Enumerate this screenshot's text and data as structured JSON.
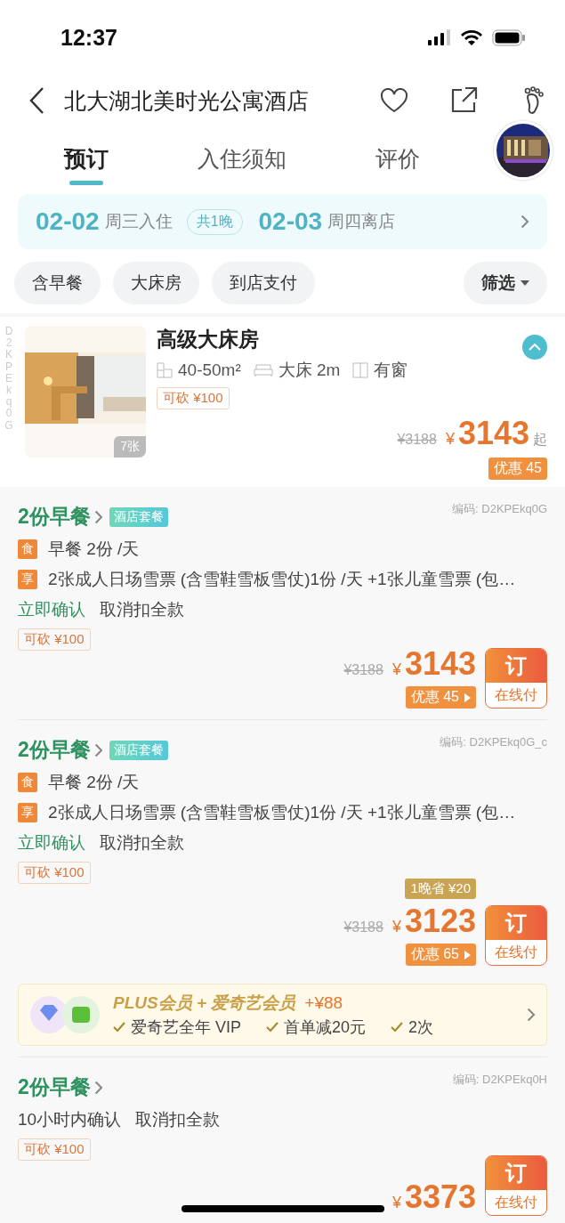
{
  "status_bar": {
    "time": "12:37"
  },
  "header": {
    "title": "北大湖北美时光公寓酒店"
  },
  "tabs": [
    {
      "label": "预订",
      "selected": true
    },
    {
      "label": "入住须知",
      "selected": false
    },
    {
      "label": "评价",
      "selected": false
    }
  ],
  "dates": {
    "checkin_date": "02-02",
    "checkin_label": "周三入住",
    "nights": "共1晚",
    "checkout_date": "02-03",
    "checkout_label": "周四离店"
  },
  "filters": [
    {
      "label": "含早餐",
      "kind": "chip"
    },
    {
      "label": "大床房",
      "kind": "chip"
    },
    {
      "label": "到店支付",
      "kind": "chip"
    },
    {
      "label": "筛选",
      "kind": "dropdown"
    }
  ],
  "room": {
    "side_code": "D2KPEkq0G",
    "photo_count": "7张",
    "name": "高级大床房",
    "expanded": true,
    "features": [
      {
        "kind": "area",
        "text": "40-50m²"
      },
      {
        "kind": "bed",
        "text": "大床 2m"
      },
      {
        "kind": "window",
        "text": "有窗"
      }
    ],
    "bargain": "可砍 ¥100",
    "old_price": "¥3188",
    "currency": "¥",
    "price": "3143",
    "suffix": "起",
    "discount": "优惠 45"
  },
  "packages": [
    {
      "title": "2份早餐",
      "tag": "酒店套餐",
      "code": "编码: D2KPEkq0G",
      "perks": [
        {
          "icon": "食",
          "text": "早餐 2份 /天"
        },
        {
          "icon": "享",
          "text": "2张成人日场雪票 (含雪鞋雪板雪仗)1份 /天 +1张儿童雪票 (包…"
        }
      ],
      "confirm": "立即确认",
      "instant": true,
      "cancel": "取消扣全款",
      "bargain": "可砍 ¥100",
      "old_price": "¥3188",
      "currency": "¥",
      "price": "3143",
      "discount": "优惠 45",
      "book": "订",
      "pay": "在线付"
    },
    {
      "title": "2份早餐",
      "tag": "酒店套餐",
      "code": "编码: D2KPEkq0G_c",
      "perks": [
        {
          "icon": "食",
          "text": "早餐 2份 /天"
        },
        {
          "icon": "享",
          "text": "2张成人日场雪票 (含雪鞋雪板雪仗)1份 /天 +1张儿童雪票 (包…"
        }
      ],
      "confirm": "立即确认",
      "instant": true,
      "cancel": "取消扣全款",
      "bargain": "可砍 ¥100",
      "saving": "1晚省 ¥20",
      "old_price": "¥3188",
      "currency": "¥",
      "price": "3123",
      "discount": "优惠 65",
      "book": "订",
      "pay": "在线付",
      "member": {
        "title": "PLUS会员 + 爱奇艺会员",
        "extra": "+¥88",
        "benefits": [
          "爱奇艺全年 VIP",
          "首单减20元",
          "2次"
        ]
      }
    },
    {
      "title": "2份早餐",
      "code": "编码: D2KPEkq0H",
      "confirm": "10小时内确认",
      "instant": false,
      "cancel": "取消扣全款",
      "bargain": "可砍 ¥100",
      "currency": "¥",
      "price": "3373",
      "book": "订",
      "pay": "在线付"
    }
  ]
}
